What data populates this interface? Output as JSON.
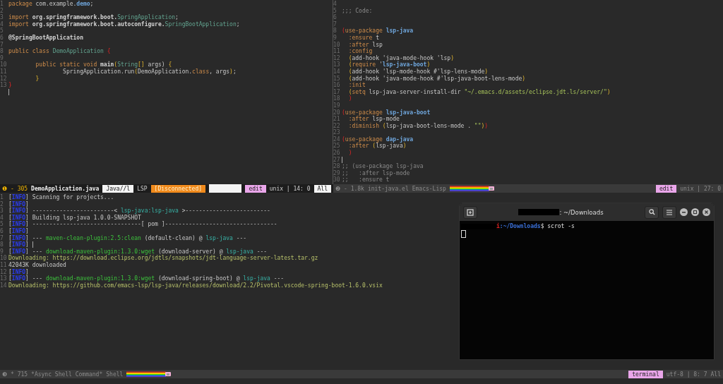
{
  "panes": [
    {
      "kind": "editor",
      "lines": [
        {
          "n": "1",
          "segs": [
            {
              "text": "package",
              "kind": "kw"
            },
            {
              "text": " com.example.",
              "kind": "plain"
            },
            {
              "text": "demo",
              "kind": "const"
            },
            {
              "text": ";",
              "kind": "plain"
            }
          ]
        },
        {
          "n": "2"
        },
        {
          "n": "3",
          "segs": [
            {
              "text": "import",
              "kind": "kw"
            },
            {
              "text": " org.springframework.boot.",
              "kind": "bold"
            },
            {
              "text": "SpringApplication",
              "kind": "type"
            },
            {
              "text": ";",
              "kind": "plain"
            }
          ]
        },
        {
          "n": "4",
          "segs": [
            {
              "text": "import",
              "kind": "kw"
            },
            {
              "text": " org.springframework.boot.autoconfigure.",
              "kind": "bold"
            },
            {
              "text": "SpringBootApplication",
              "kind": "type"
            },
            {
              "text": ";",
              "kind": "plain"
            }
          ]
        },
        {
          "n": "5"
        },
        {
          "n": "6",
          "segs": [
            {
              "text": "@SpringBootApplication",
              "kind": "bold"
            }
          ]
        },
        {
          "n": "7"
        },
        {
          "n": "8",
          "segs": [
            {
              "text": "public class ",
              "kind": "kw"
            },
            {
              "text": "DemoApplication",
              "kind": "type"
            },
            {
              "text": " {",
              "kind": "red"
            }
          ]
        },
        {
          "n": "9"
        },
        {
          "n": "10",
          "segs": [
            {
              "text": "        public static void ",
              "kind": "kw"
            },
            {
              "text": "main",
              "kind": "bold"
            },
            {
              "text": "(",
              "kind": "yellow"
            },
            {
              "text": "String",
              "kind": "type"
            },
            {
              "text": "[]",
              "kind": "yellow"
            },
            {
              "text": " args) ",
              "kind": "plain"
            },
            {
              "text": "{",
              "kind": "yellow"
            }
          ]
        },
        {
          "n": "11",
          "segs": [
            {
              "text": "                SpringApplication.run",
              "kind": "plain"
            },
            {
              "text": "(",
              "kind": "yellow"
            },
            {
              "text": "DemoApplication.",
              "kind": "plain"
            },
            {
              "text": "class",
              "kind": "kw"
            },
            {
              "text": ", args",
              "kind": "plain"
            },
            {
              "text": ")",
              "kind": "yellow"
            },
            {
              "text": ";",
              "kind": "plain"
            }
          ]
        },
        {
          "n": "12",
          "segs": [
            {
              "text": "        }",
              "kind": "yellow"
            }
          ]
        },
        {
          "n": "13",
          "segs": [
            {
              "text": "}",
              "kind": "red"
            }
          ]
        },
        {
          "cursor": true
        }
      ]
    },
    {
      "kind": "editor",
      "lines": [
        {
          "n": "4"
        },
        {
          "n": "5",
          "segs": [
            {
              "text": ";;; Code:",
              "kind": "comment"
            }
          ]
        },
        {
          "n": "6"
        },
        {
          "n": "7"
        },
        {
          "n": "8",
          "segs": [
            {
              "text": "(",
              "kind": "red"
            },
            {
              "text": "use-package ",
              "kind": "kw"
            },
            {
              "text": "lsp-java",
              "kind": "const"
            }
          ]
        },
        {
          "n": "9",
          "segs": [
            {
              "text": "  :ensure ",
              "kind": "kw"
            },
            {
              "text": "t",
              "kind": "plain"
            }
          ]
        },
        {
          "n": "10",
          "segs": [
            {
              "text": "  :after ",
              "kind": "kw"
            },
            {
              "text": "lsp",
              "kind": "plain"
            }
          ]
        },
        {
          "n": "11",
          "segs": [
            {
              "text": "  :config",
              "kind": "kw"
            }
          ]
        },
        {
          "n": "12",
          "segs": [
            {
              "text": "  (",
              "kind": "yellow"
            },
            {
              "text": "add-hook 'java-mode-hook 'lsp",
              "kind": "plain"
            },
            {
              "text": ")",
              "kind": "yellow"
            }
          ]
        },
        {
          "n": "13",
          "segs": [
            {
              "text": "  (",
              "kind": "yellow"
            },
            {
              "text": "require ",
              "kind": "kw"
            },
            {
              "text": "'",
              "kind": "plain"
            },
            {
              "text": "lsp-java-boot",
              "kind": "const"
            },
            {
              "text": ")",
              "kind": "yellow"
            }
          ]
        },
        {
          "n": "14",
          "segs": [
            {
              "text": "  (",
              "kind": "yellow"
            },
            {
              "text": "add-hook 'lsp-mode-hook #'lsp-lens-mode",
              "kind": "plain"
            },
            {
              "text": ")",
              "kind": "yellow"
            }
          ]
        },
        {
          "n": "15",
          "segs": [
            {
              "text": "  (",
              "kind": "yellow"
            },
            {
              "text": "add-hook 'java-mode-hook #'lsp-java-boot-lens-mode",
              "kind": "plain"
            },
            {
              "text": ")",
              "kind": "yellow"
            }
          ]
        },
        {
          "n": "16",
          "segs": [
            {
              "text": "  :init",
              "kind": "kw"
            }
          ]
        },
        {
          "n": "17",
          "segs": [
            {
              "text": "  (",
              "kind": "yellow"
            },
            {
              "text": "setq ",
              "kind": "kw"
            },
            {
              "text": "lsp-java-server-install-dir ",
              "kind": "plain"
            },
            {
              "text": "\"~/.emacs.d/assets/eclipse.jdt.ls/server/\"",
              "kind": "str"
            },
            {
              "text": ")",
              "kind": "yellow"
            }
          ]
        },
        {
          "n": "18",
          "segs": [
            {
              "text": "  )",
              "kind": "red"
            }
          ]
        },
        {
          "n": "19"
        },
        {
          "n": "20",
          "segs": [
            {
              "text": "(",
              "kind": "red"
            },
            {
              "text": "use-package ",
              "kind": "kw"
            },
            {
              "text": "lsp-java-boot",
              "kind": "const"
            }
          ]
        },
        {
          "n": "21",
          "segs": [
            {
              "text": "  :after ",
              "kind": "kw"
            },
            {
              "text": "lsp-mode",
              "kind": "plain"
            }
          ]
        },
        {
          "n": "22",
          "segs": [
            {
              "text": "  :diminish ",
              "kind": "kw"
            },
            {
              "text": "(",
              "kind": "yellow"
            },
            {
              "text": "lsp-java-boot-lens-mode . ",
              "kind": "plain"
            },
            {
              "text": "\"\"",
              "kind": "str"
            },
            {
              "text": ")",
              "kind": "yellow"
            },
            {
              "text": ")",
              "kind": "red"
            }
          ]
        },
        {
          "n": "23"
        },
        {
          "n": "24",
          "segs": [
            {
              "text": "(",
              "kind": "red"
            },
            {
              "text": "use-package ",
              "kind": "kw"
            },
            {
              "text": "dap-java",
              "kind": "const"
            }
          ]
        },
        {
          "n": "25",
          "segs": [
            {
              "text": "  :after ",
              "kind": "kw"
            },
            {
              "text": "(",
              "kind": "yellow"
            },
            {
              "text": "lsp-java",
              "kind": "plain"
            },
            {
              "text": ")",
              "kind": "yellow"
            }
          ]
        },
        {
          "n": "26",
          "segs": [
            {
              "text": "  )",
              "kind": "red"
            }
          ]
        },
        {
          "n": "27",
          "cursor": true
        },
        {
          "n": "28",
          "segs": [
            {
              "text": ";; (use-package lsp-java",
              "kind": "comment"
            }
          ]
        },
        {
          "n": "29",
          "segs": [
            {
              "text": ";;   :after lsp-mode",
              "kind": "comment"
            }
          ]
        },
        {
          "n": "30",
          "segs": [
            {
              "text": ";;   :ensure t",
              "kind": "comment"
            }
          ]
        }
      ]
    }
  ],
  "top_modelines": [
    {
      "active": true,
      "segs": [
        {
          "text": "❶",
          "kind": "accent"
        },
        {
          "text": "- 305",
          "kind": "accent"
        },
        {
          "text": "DemoApplication.java",
          "kind": "bold"
        },
        {
          "text": "Java//l",
          "kind": "white"
        },
        {
          "text": "LSP",
          "kind": "plain"
        },
        {
          "text": "[Disconnected]",
          "kind": "orange"
        },
        {
          "kind": "spacer"
        },
        {
          "text": "edit",
          "kind": "pink"
        },
        {
          "text": "unix | 14: 0",
          "kind": "plain"
        },
        {
          "text": "All",
          "kind": "white"
        }
      ]
    },
    {
      "active": false,
      "segs": [
        {
          "text": "❷",
          "kind": "plain"
        },
        {
          "text": "- 1.8k",
          "kind": "plain"
        },
        {
          "text": "init-java.el",
          "kind": "plain"
        },
        {
          "text": "Emacs-Lisp",
          "kind": "plain"
        },
        {
          "kind": "nyan"
        },
        {
          "kind": "spacer"
        },
        {
          "text": "edit",
          "kind": "pink"
        },
        {
          "text": "unix | 27: 0",
          "kind": "plain"
        }
      ]
    }
  ],
  "shell": {
    "lines": [
      {
        "n": "1",
        "segs": [
          {
            "text": "[",
            "kind": "plain"
          },
          {
            "text": "INFO",
            "kind": "info"
          },
          {
            "text": "] Scanning for projects...",
            "kind": "plain"
          }
        ]
      },
      {
        "n": "2",
        "segs": [
          {
            "text": "[",
            "kind": "plain"
          },
          {
            "text": "INFO",
            "kind": "info"
          },
          {
            "text": "]",
            "kind": "plain"
          }
        ]
      },
      {
        "n": "3",
        "segs": [
          {
            "text": "[",
            "kind": "plain"
          },
          {
            "text": "INFO",
            "kind": "info"
          },
          {
            "text": "] ------------------------< ",
            "kind": "plain"
          },
          {
            "text": "lsp-java:lsp-java",
            "kind": "teal"
          },
          {
            "text": " >-------------------------",
            "kind": "plain"
          }
        ]
      },
      {
        "n": "4",
        "segs": [
          {
            "text": "[",
            "kind": "plain"
          },
          {
            "text": "INFO",
            "kind": "info"
          },
          {
            "text": "] Building lsp-java 1.0.0-SNAPSHOT",
            "kind": "plain"
          }
        ]
      },
      {
        "n": "5",
        "segs": [
          {
            "text": "[",
            "kind": "plain"
          },
          {
            "text": "INFO",
            "kind": "info"
          },
          {
            "text": "] --------------------------------[ pom ]---------------------------------",
            "kind": "plain"
          }
        ]
      },
      {
        "n": "6",
        "segs": [
          {
            "text": "[",
            "kind": "plain"
          },
          {
            "text": "INFO",
            "kind": "info"
          },
          {
            "text": "]",
            "kind": "plain"
          }
        ]
      },
      {
        "n": "7",
        "segs": [
          {
            "text": "[",
            "kind": "plain"
          },
          {
            "text": "INFO",
            "kind": "info"
          },
          {
            "text": "] --- ",
            "kind": "plain"
          },
          {
            "text": "maven-clean-plugin:2.5:clean",
            "kind": "green"
          },
          {
            "text": " (default-clean) @ ",
            "kind": "plain"
          },
          {
            "text": "lsp-java",
            "kind": "teal"
          },
          {
            "text": " ---",
            "kind": "plain"
          }
        ]
      },
      {
        "n": "8",
        "segs": [
          {
            "text": "[",
            "kind": "plain"
          },
          {
            "text": "INFO",
            "kind": "info"
          },
          {
            "text": "] ",
            "kind": "plain"
          }
        ],
        "cursor": true
      },
      {
        "n": "9",
        "segs": [
          {
            "text": "[",
            "kind": "plain"
          },
          {
            "text": "INFO",
            "kind": "info"
          },
          {
            "text": "] --- ",
            "kind": "plain"
          },
          {
            "text": "download-maven-plugin:1.3.0:wget",
            "kind": "green"
          },
          {
            "text": " (download-server) @ ",
            "kind": "plain"
          },
          {
            "text": "lsp-java",
            "kind": "teal"
          },
          {
            "text": " ---",
            "kind": "plain"
          }
        ]
      },
      {
        "n": "10",
        "segs": [
          {
            "text": "Downloading: https://download.eclipse.org/jdtls/snapshots/jdt-language-server-latest.tar.gz",
            "kind": "dl"
          }
        ]
      },
      {
        "n": "11",
        "segs": [
          {
            "text": "42043K downloaded",
            "kind": "plain"
          }
        ]
      },
      {
        "n": "12",
        "segs": [
          {
            "text": "[",
            "kind": "plain"
          },
          {
            "text": "INFO",
            "kind": "info"
          },
          {
            "text": "]",
            "kind": "plain"
          }
        ]
      },
      {
        "n": "13",
        "segs": [
          {
            "text": "[",
            "kind": "plain"
          },
          {
            "text": "INFO",
            "kind": "info"
          },
          {
            "text": "] --- ",
            "kind": "plain"
          },
          {
            "text": "download-maven-plugin:1.3.0:wget",
            "kind": "green"
          },
          {
            "text": " (download-spring-boot) @ ",
            "kind": "plain"
          },
          {
            "text": "lsp-java",
            "kind": "teal"
          },
          {
            "text": " ---",
            "kind": "plain"
          }
        ]
      },
      {
        "n": "14",
        "segs": [
          {
            "text": "Downloading: https://github.com/emacs-lsp/lsp-java/releases/download/2.2/Pivotal.vscode-spring-boot-1.6.0.vsix",
            "kind": "dl"
          }
        ]
      }
    ]
  },
  "shell_modeline": {
    "active": false,
    "segs": [
      {
        "text": "❸",
        "kind": "plain"
      },
      {
        "text": "* 715",
        "kind": "plain"
      },
      {
        "text": "*Async Shell Command*",
        "kind": "plain"
      },
      {
        "text": "Shell",
        "kind": "plain"
      },
      {
        "kind": "nyan"
      },
      {
        "kind": "spacer"
      },
      {
        "text": "terminal",
        "kind": "pink"
      },
      {
        "text": "utf-8 | 8: 7",
        "kind": "plain"
      },
      {
        "text": "All",
        "kind": "plain"
      }
    ]
  },
  "terminal": {
    "title": ": ~/Downloads",
    "prompt_host": "i",
    "prompt_path": ":~/Downloads",
    "prompt_cmd": "$ scrot -s"
  }
}
